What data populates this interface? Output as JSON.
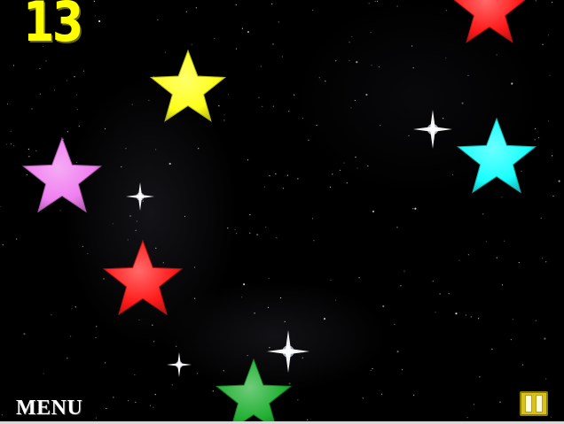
{
  "hud": {
    "score": "13",
    "score_color": "#ffff00",
    "menu_label": "MENU",
    "menu_color": "#ffffff",
    "pause_icon": "pause-icon",
    "pause_color": "#d9c21a"
  },
  "game": {
    "stars": [
      {
        "name": "star-red-top",
        "color": "#ff1a1a"
      },
      {
        "name": "star-yellow",
        "color": "#ffff1a"
      },
      {
        "name": "star-cyan",
        "color": "#1affff"
      },
      {
        "name": "star-pink",
        "color": "#f07ef0"
      },
      {
        "name": "star-red-middle",
        "color": "#ff1a1a"
      },
      {
        "name": "star-green",
        "color": "#22b033"
      }
    ],
    "sparkles": [
      "sparkle-icon",
      "sparkle-icon",
      "sparkle-icon",
      "sparkle-icon"
    ],
    "background": "#000000"
  }
}
